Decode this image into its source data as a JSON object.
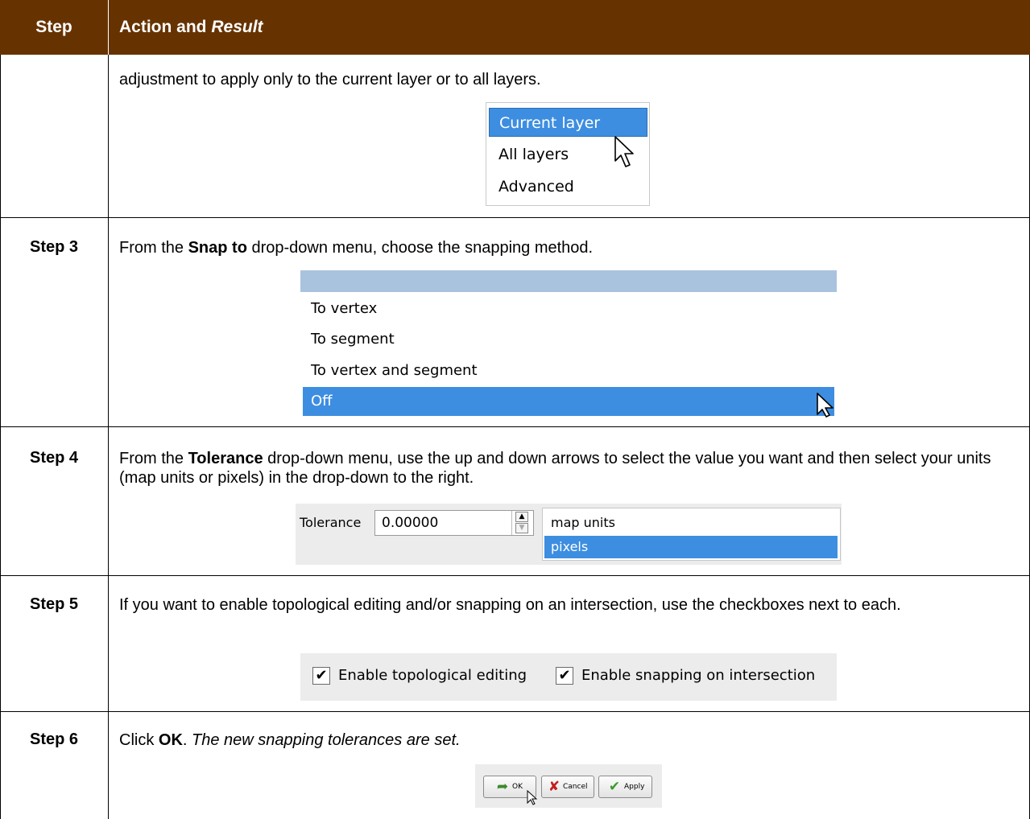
{
  "header": {
    "step_label": "Step",
    "action_label": "Action and ",
    "result_label": "Result"
  },
  "rows": {
    "r2": {
      "text": "adjustment to apply only to the current layer or to all layers."
    },
    "r3": {
      "step": "Step 3",
      "pre": "From the ",
      "bold": "Snap to",
      "post": " drop-down menu, choose the snapping method."
    },
    "r4": {
      "step": "Step 4",
      "pre": "From the ",
      "bold": "Tolerance",
      "post": " drop-down menu, use the up and down arrows to select the value you want and then select your units (map units or pixels) in the drop-down to the right."
    },
    "r5": {
      "step": "Step 5",
      "text": "If you want to enable topological editing and/or snapping on an intersection, use the checkboxes next to each."
    },
    "r6": {
      "step": "Step 6",
      "pre": "Click ",
      "bold": "OK",
      "mid": ". ",
      "italic": "The new snapping tolerances are set."
    }
  },
  "layer_menu": {
    "options": [
      "Current layer",
      "All layers",
      "Advanced"
    ],
    "selected": "Current layer"
  },
  "snap_menu": {
    "options": [
      "To vertex",
      "To segment",
      "To vertex and segment",
      "Off"
    ],
    "selected": "Off"
  },
  "tolerance": {
    "label": "Tolerance",
    "value": "0.00000",
    "units": [
      "map units",
      "pixels"
    ],
    "selected_unit": "pixels"
  },
  "checkboxes": [
    {
      "label": "Enable topological editing",
      "checked": true
    },
    {
      "label": "Enable snapping on intersection",
      "checked": true
    }
  ],
  "buttons": {
    "ok": "OK",
    "cancel": "Cancel",
    "apply": "Apply"
  },
  "colors": {
    "header_bg": "#663300",
    "selection": "#3d8ee0"
  }
}
